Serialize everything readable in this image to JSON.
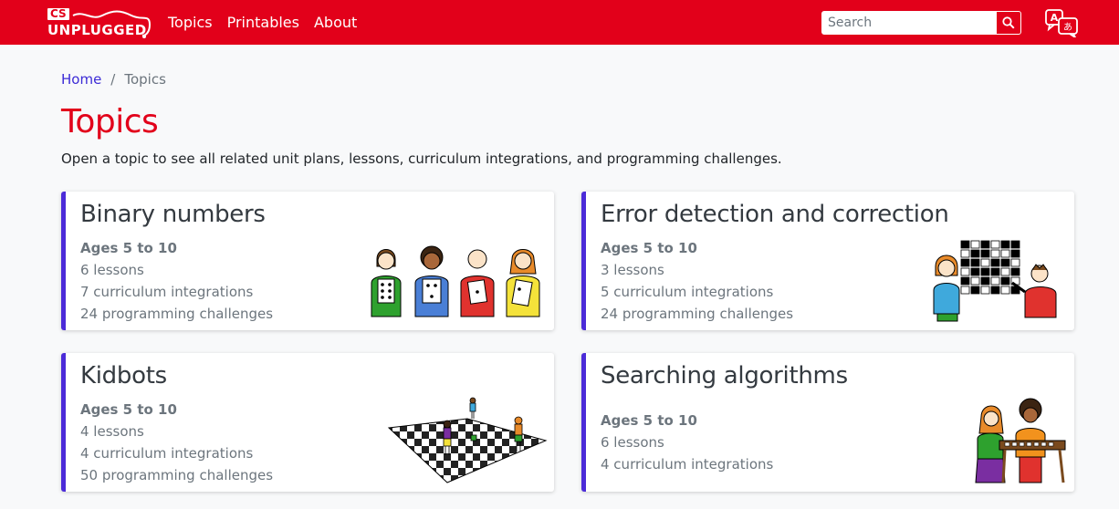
{
  "navbar": {
    "logo": {
      "cs": "CS",
      "name": "UNPLUGGED"
    },
    "links": [
      "Topics",
      "Printables",
      "About"
    ],
    "search_placeholder": "Search",
    "search_icon": "search-icon",
    "language_icon": "translate-icon"
  },
  "breadcrumb": {
    "home": "Home",
    "separator": "/",
    "current": "Topics"
  },
  "page": {
    "title": "Topics",
    "intro": "Open a topic to see all related unit plans, lessons, curriculum integrations, and programming challenges."
  },
  "colors": {
    "brand_red": "#e2001a",
    "card_accent": "#4b2bd8",
    "link": "#3c2bd6"
  },
  "topics": [
    {
      "title": "Binary numbers",
      "ages": "Ages 5 to 10",
      "lessons": "6 lessons",
      "integrations": "7 curriculum integrations",
      "challenges": "24 programming challenges"
    },
    {
      "title": "Error detection and correction",
      "ages": "Ages 5 to 10",
      "lessons": "3 lessons",
      "integrations": "5 curriculum integrations",
      "challenges": "24 programming challenges"
    },
    {
      "title": "Kidbots",
      "ages": "Ages 5 to 10",
      "lessons": "4 lessons",
      "integrations": "4 curriculum integrations",
      "challenges": "50 programming challenges"
    },
    {
      "title": "Searching algorithms",
      "ages": "Ages 5 to 10",
      "lessons": "6 lessons",
      "integrations": "4 curriculum integrations"
    }
  ]
}
